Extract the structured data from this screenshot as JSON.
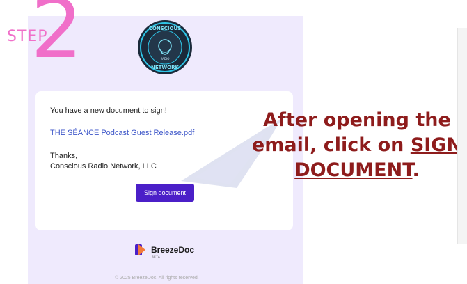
{
  "step": {
    "word": "STEP",
    "number": "2"
  },
  "logo": {
    "icon": "conscious-radio-network-logo",
    "top_text": "CONSCIOUS",
    "middle_text": "RADIO",
    "bottom_text": "NETWORK"
  },
  "email": {
    "message": "You have a new document to sign!",
    "link": "THE SÉANCE Podcast Guest Release.pdf",
    "thanks": "Thanks,",
    "company": "Conscious Radio Network, LLC",
    "button_label": "Sign document",
    "button_color": "#4b1fc8",
    "footer_brand": "BreezeDoc",
    "footer_beta": "BETA",
    "copyright": "© 2025 BreezeDoc. All rights reserved."
  },
  "instruction": {
    "line1": "After opening the",
    "line2_prefix": "email, click on ",
    "line2_link": "SIGN",
    "line3": "DOCUMENT",
    "line3_suffix": ".",
    "color": "#8e1c1c"
  },
  "colors": {
    "step": "#f06fc9",
    "email_bg": "#efeafd",
    "arrow": "#c5cbe6"
  }
}
